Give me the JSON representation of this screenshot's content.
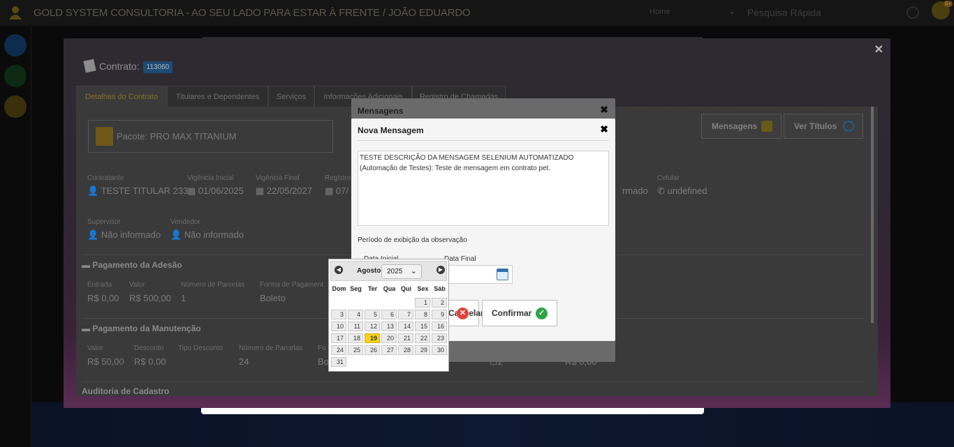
{
  "app": {
    "title": "GOLD SYSTEM CONSULTORIA - AO SEU LADO PARA ESTAR À FRENTE / JOÃO EDUARDO",
    "home_select": "Home",
    "quick_search_placeholder": "Pesquisa Rápida",
    "notif_count": "6+"
  },
  "contract": {
    "title": "Contrato:",
    "number": "113060",
    "tabs": [
      "Detalhes do Contrato",
      "Titulares e Dependentes",
      "Serviços",
      "Informações Adicionais",
      "Registro de Chamadas"
    ],
    "package": "Pacote: PRO MAX TITANIUM",
    "btn_mensagens": "Mensagens",
    "btn_ver_titulos": "Ver Títulos",
    "info": {
      "contratante_lbl": "Contratante",
      "contratante": "TESTE TITULAR 233",
      "vig_ini_lbl": "Vigência Inicial",
      "vig_ini": "01/06/2025",
      "vig_fin_lbl": "Vigência Final",
      "vig_fin": "22/05/2027",
      "registro_lbl": "Registro",
      "registro": "07/",
      "informado_frag": "rmado",
      "celular_lbl": "Celular",
      "celular": "undefined",
      "supervisor_lbl": "Supervisor",
      "supervisor": "Não informado",
      "vendedor_lbl": "Vendedor",
      "vendedor": "Não informado"
    },
    "adesao": {
      "title": "Pagamento da Adesão",
      "entrada_lbl": "Entrada",
      "entrada": "R$ 0,00",
      "valor_lbl": "Valor",
      "valor": "R$ 500,00",
      "parcelas_lbl": "Número de Parcelas",
      "parcelas": "1",
      "forma_lbl": "Forma de Pagament",
      "forma": "Boleto"
    },
    "manutencao": {
      "title": "Pagamento da Manutenção",
      "valor_lbl": "Valor",
      "valor": "R$ 50,00",
      "desconto_lbl": "Desconto",
      "desconto": "R$ 0,00",
      "tipo_lbl": "Tipo Desconto",
      "parcelas_lbl": "Número de Parcelas",
      "parcelas": "24",
      "fo_lbl": "Fo",
      "fo_val": "Bo",
      "extra1": "2",
      "extra2": "R$ 0,00"
    },
    "auditoria": "Auditoria de Cadastro"
  },
  "mensagens": {
    "title": "Mensagens"
  },
  "nova": {
    "title": "Nova Mensagem",
    "message": "TESTE DESCRIÇÃO DA MENSAGEM SELENIUM AUTOMATIZADO\n(Automação de Testes): Teste de mensagem em contrato pet.",
    "periodo": "Período de exibição da observação",
    "data_inicial": "Data Inicial",
    "data_final": "Data Final",
    "btn_cancel": "Cancelar",
    "btn_confirm": "Confirmar"
  },
  "datepicker": {
    "month": "Agosto",
    "year": "2025",
    "dow": [
      "Dom",
      "Seg",
      "Ter",
      "Qua",
      "Qui",
      "Sex",
      "Sáb"
    ],
    "first_weekday": 5,
    "days": [
      "1",
      "2",
      "3",
      "4",
      "5",
      "6",
      "7",
      "8",
      "9",
      "10",
      "11",
      "12",
      "13",
      "14",
      "15",
      "16",
      "17",
      "18",
      "19",
      "20",
      "21",
      "22",
      "23",
      "24",
      "25",
      "26",
      "27",
      "28",
      "29",
      "30",
      "31"
    ],
    "today": "19"
  }
}
